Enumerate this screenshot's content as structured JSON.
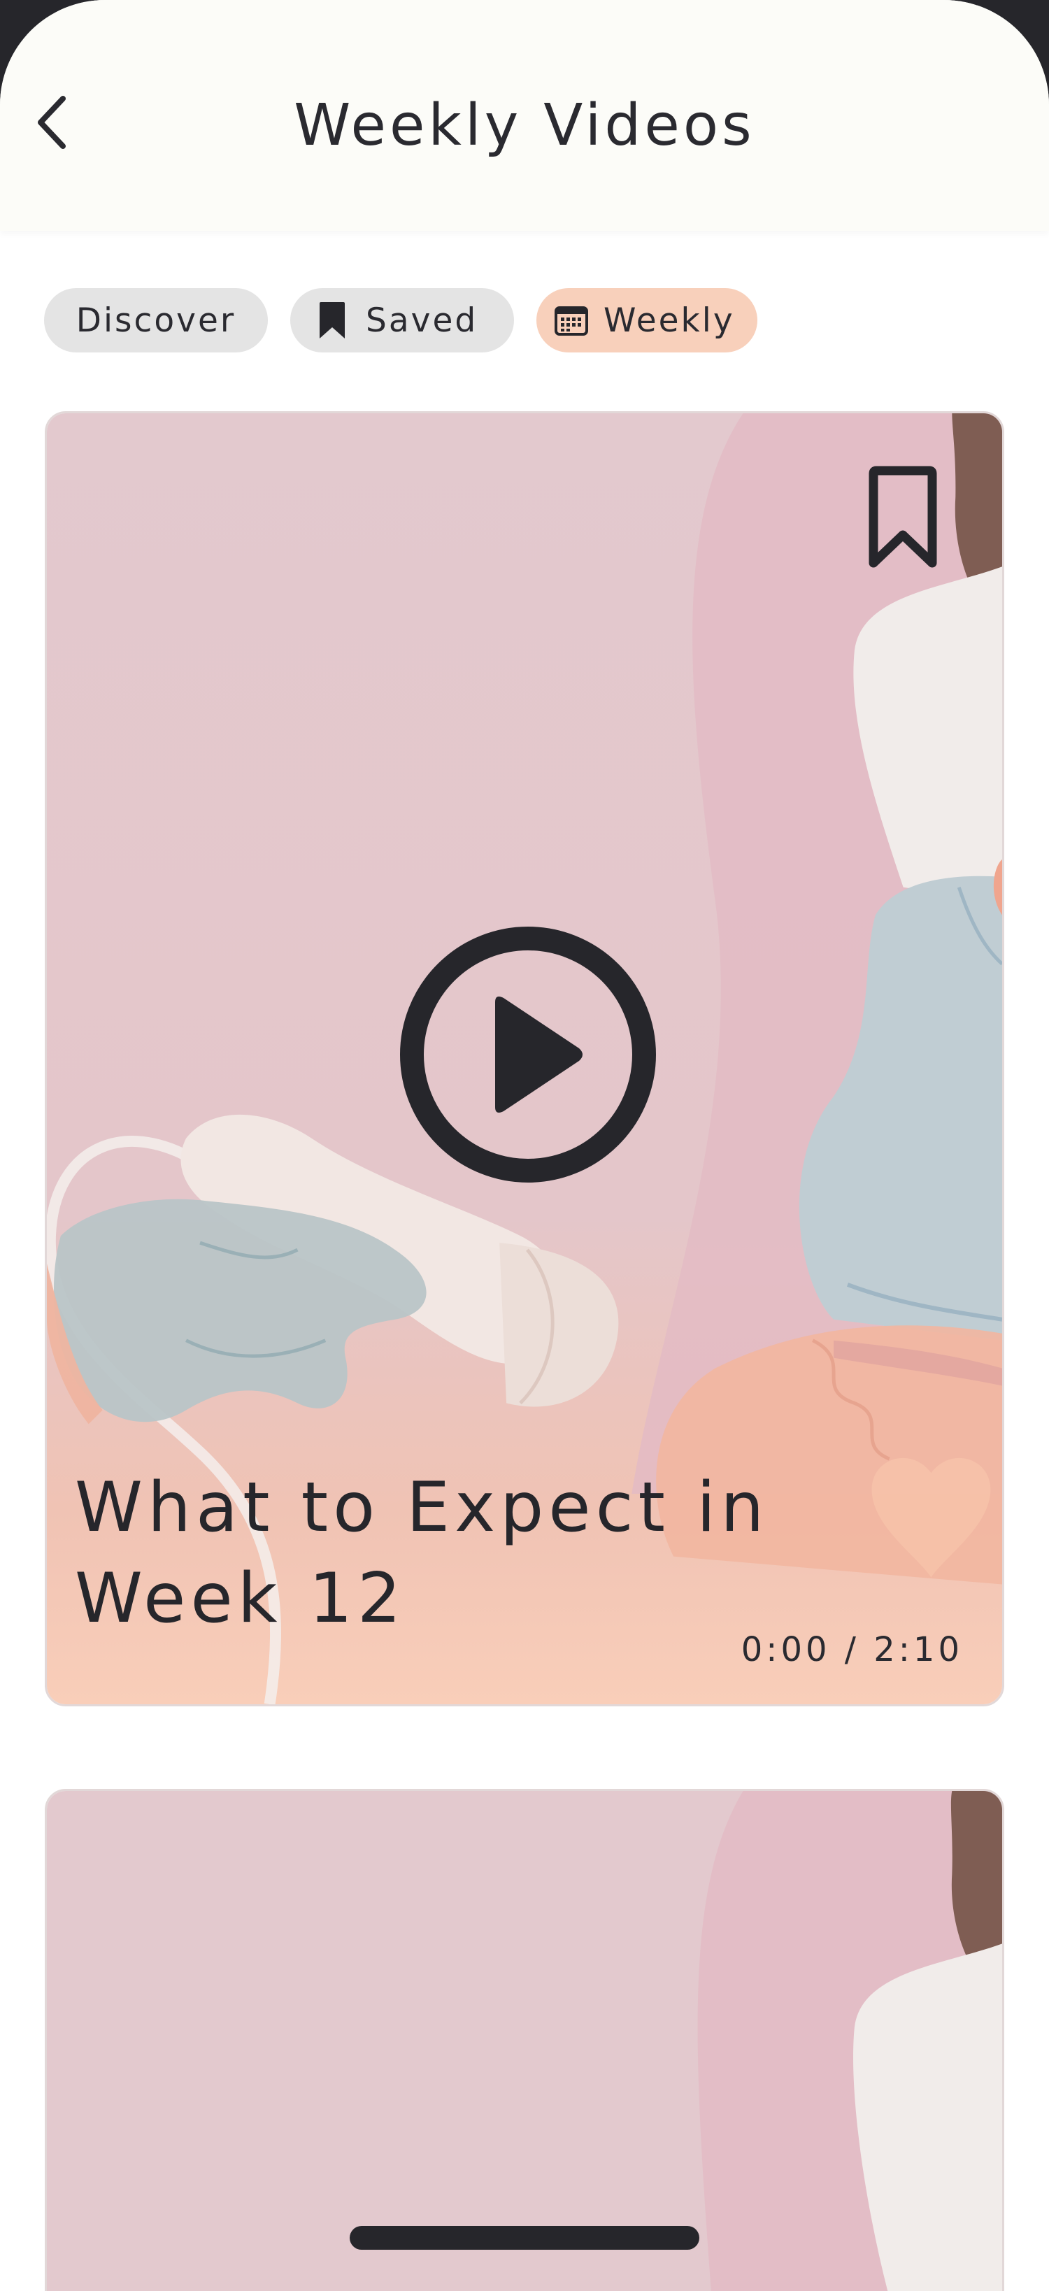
{
  "header": {
    "title": "Weekly Videos",
    "back_icon": "chevron-left-icon"
  },
  "tabs": [
    {
      "label": "Discover",
      "icon": "",
      "active": false
    },
    {
      "label": "Saved",
      "icon": "bookmark-icon",
      "active": false
    },
    {
      "label": "Weekly",
      "icon": "calendar-icon",
      "active": true
    }
  ],
  "videos": [
    {
      "title_line1": "What to Expect in",
      "title_line2": "Week 12",
      "time": "0:00 / 2:10",
      "bookmark_icon": "bookmark-outline-icon",
      "play_icon": "play-circle-icon"
    }
  ],
  "colors": {
    "active_tab": "#f8d0bb",
    "inactive_tab": "#e4e4e4",
    "text": "#2a2a30",
    "header_bg": "#fcfcf8",
    "card_pink": "#e3c8ce",
    "card_peach": "#f8cdb8"
  }
}
